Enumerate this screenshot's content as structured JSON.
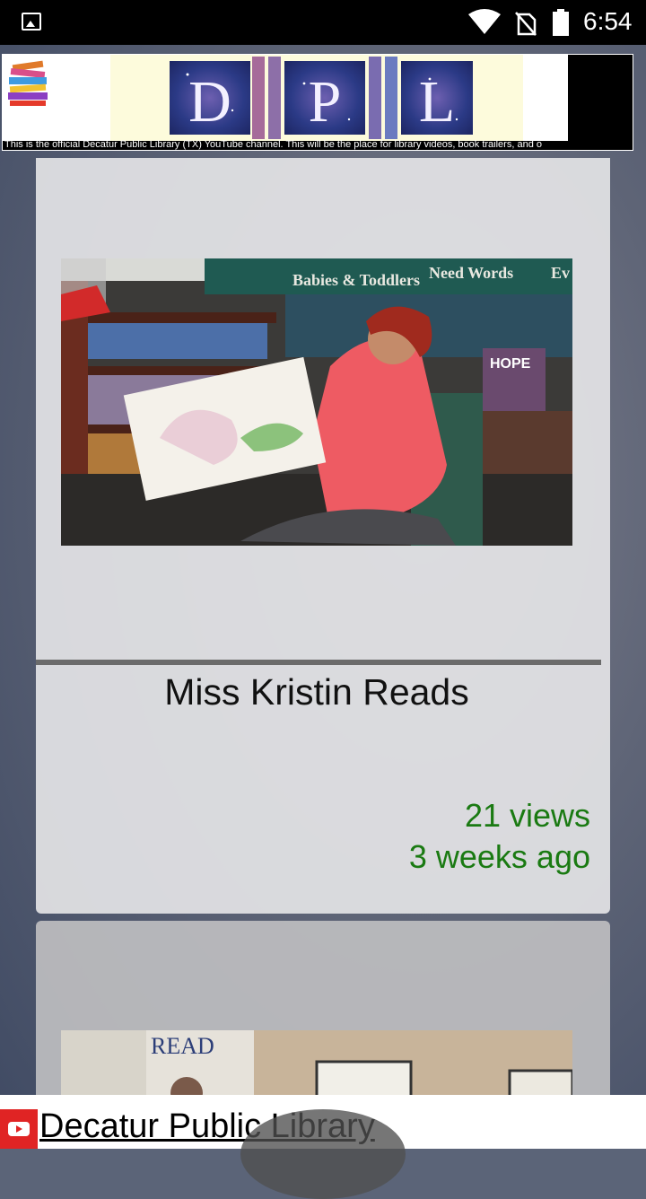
{
  "status_bar": {
    "time": "6:54",
    "icons": [
      "image-icon",
      "wifi-icon",
      "no-sim-icon",
      "battery-icon"
    ]
  },
  "banner": {
    "letters": [
      "D",
      "P",
      "L"
    ],
    "description": "This is the official Decatur Public Library (TX) YouTube channel. This will be the place for library videos, book trailers, and o"
  },
  "videos": [
    {
      "title": "Miss Kristin Reads",
      "views": "21 views",
      "age": "3 weeks ago",
      "thumbnail_text": [
        "Babies & Toddlers",
        "Need Words",
        "Ev",
        "HOPE"
      ]
    },
    {
      "thumbnail_text": [
        "READ"
      ]
    }
  ],
  "footer": {
    "channel_name": "Decatur Public Library"
  }
}
